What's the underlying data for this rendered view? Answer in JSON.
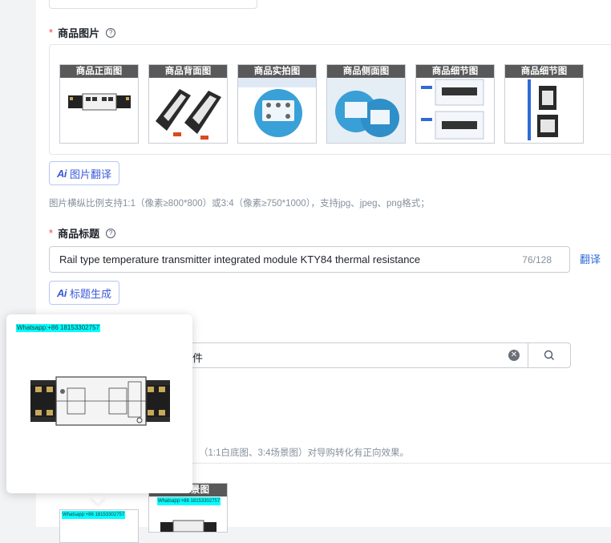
{
  "images_section": {
    "label": "商品图片",
    "thumbnails": [
      {
        "label": "商品正面图"
      },
      {
        "label": "商品背面图"
      },
      {
        "label": "商品实拍图"
      },
      {
        "label": "商品侧面图"
      },
      {
        "label": "商品细节图"
      },
      {
        "label": "商品细节图"
      }
    ],
    "translate_button": "图片翻译",
    "hint": "图片横纵比例支持1:1（像素≥800*800）或3:4（像素≥750*1000），支持jpg、jpeg、png格式；"
  },
  "title_section": {
    "label": "商品标题",
    "value": "Rail type temperature transmitter integrated module KTY84 thermal resistance",
    "counter": "76/128",
    "translate_link": "翻译",
    "generate_button": "标题生成"
  },
  "search": {
    "value_fragment": "件"
  },
  "hint2": "（1:1白底图、3:4场景图）对导购转化有正向效果。",
  "lower_thumb_label": "景图",
  "popup": {
    "watermark": "Whatsapp:+86 18153302757"
  },
  "colors": {
    "accent": "#2f6bd9",
    "required": "#f53f3f",
    "watermark_bg": "#00ffff"
  }
}
